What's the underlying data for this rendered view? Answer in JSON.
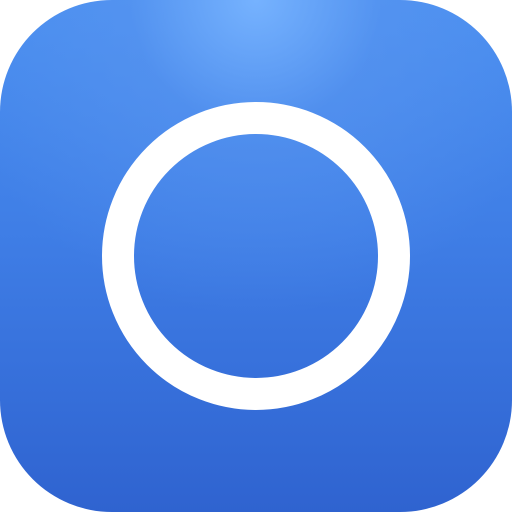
{
  "app_icon": {
    "icon_name": "circle-ring-icon",
    "colors": {
      "gradient_top": "#6AAAFF",
      "gradient_mid": "#3F7EE6",
      "gradient_bottom": "#2F63D0",
      "ring": "#FFFFFF"
    }
  }
}
